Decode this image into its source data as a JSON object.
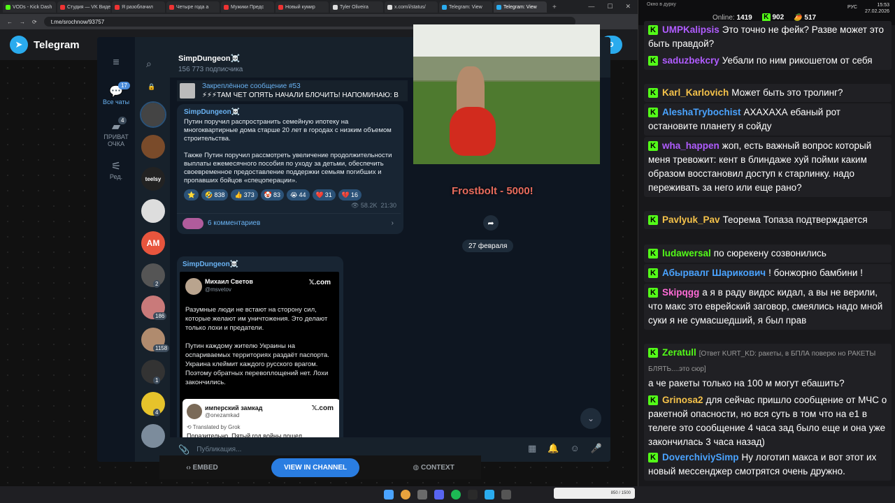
{
  "browser": {
    "tabs": [
      {
        "label": "VODs - Kick Dash",
        "color": "#53fc18"
      },
      {
        "label": "Студия — VK Видео",
        "color": "#e33"
      },
      {
        "label": "Я разоблачил",
        "color": "#e33"
      },
      {
        "label": "Четыре года а",
        "color": "#e33"
      },
      {
        "label": "Мужики Предс",
        "color": "#e33"
      },
      {
        "label": "Новый кумир",
        "color": "#e33"
      },
      {
        "label": "Tyler Oliveira",
        "color": "#ddd"
      },
      {
        "label": "x.com/i/status/",
        "color": "#ddd"
      },
      {
        "label": "Telegram: View",
        "color": "#2aabee"
      },
      {
        "label": "Telegram: View",
        "color": "#2aabee"
      }
    ],
    "url": "t.me/srochnow/93757"
  },
  "telegram_web": {
    "brand": "Telegram",
    "open_button": "D"
  },
  "tg": {
    "rail": {
      "all_chats": "Все чаты",
      "all_badge": "17",
      "private": "ПРИВАТ\nОЧКА",
      "private_badge": "4",
      "edit": "Ред."
    },
    "chat_avatars": [
      {
        "label": "",
        "color": "#444",
        "badge": ""
      },
      {
        "label": "",
        "color": "#7a4b2a",
        "badge": ""
      },
      {
        "label": "teelsy",
        "color": "#222",
        "badge": ""
      },
      {
        "label": "",
        "color": "#ddd",
        "badge": ""
      },
      {
        "label": "AM",
        "color": "#e8553d",
        "badge": ""
      },
      {
        "label": "",
        "color": "#555",
        "badge": "2"
      },
      {
        "label": "",
        "color": "#c97a7a",
        "badge": "186"
      },
      {
        "label": "",
        "color": "#b08b6e",
        "badge": "1158"
      },
      {
        "label": "",
        "color": "#333",
        "badge": "1"
      },
      {
        "label": "",
        "color": "#e6c32b",
        "badge": "4"
      },
      {
        "label": "",
        "color": "#7c8c9c",
        "badge": ""
      }
    ],
    "channel": {
      "title": "SimpDungeon☠️",
      "subscribers": "156 773 подписчика"
    },
    "pinned": {
      "title": "Закреплённое сообщение #53",
      "text": "⚡⚡⚡ТАМ ЧЕТ ОПЯТЬ НАЧАЛИ БЛОЧИТЬ! НАПОМИНАЮ: В"
    },
    "post1": {
      "author": "SimpDungeon☠️",
      "text": "Путин поручил распространить семейную ипотеку на многоквартирные дома старше 20 лет в городах с низким объемом строительства.\n\nТакже Путин поручил рассмотреть увеличение продолжительности выплаты ежемесячного пособия по уходу за детьми, обеспечить своевременное предоставление поддержки семьям погибших и пропавших бойцов «спецоперации».",
      "reactions": [
        {
          "emoji": "⭐",
          "count": ""
        },
        {
          "emoji": "🤣",
          "count": "838"
        },
        {
          "emoji": "👍",
          "count": "373"
        },
        {
          "emoji": "🤡",
          "count": "83"
        },
        {
          "emoji": "😭",
          "count": "44"
        },
        {
          "emoji": "❤️",
          "count": "31"
        },
        {
          "emoji": "💔",
          "count": "16"
        }
      ],
      "views": "👁 58.2K",
      "time": "21:30",
      "comments": "6 комментариев"
    },
    "date_divider": "27 февраля",
    "post2": {
      "author": "SimpDungeon☠️",
      "tweet_name": "Михаил Светов",
      "tweet_handle": "@msvetov",
      "tweet_site": "𝕏.com",
      "tweet_text": "Разумные люди не встают на сторону сил, которые желают им уничтожения. Это делают только лохи и предатели.\n\nПутин каждому жителю Украины на оспариваемых территориях раздаёт паспорта. Украина клеймит каждого русского врагом. Поэтому обратных перевоплощений нет. Лохи закончились.",
      "quote_name": "имперский замкад",
      "quote_handle": "@onezamkad",
      "quote_site": "𝕏.com",
      "quote_translated": "⟲ Translated by Grok",
      "quote_text": "Поразительно. Пятый год войны пошел"
    },
    "composer_placeholder": "Публикация..."
  },
  "overlay": {
    "caption": "Frostbolt - 5000!"
  },
  "extension": {
    "embed": "EMBED",
    "view": "VIEW IN CHANNEL",
    "context": "CONTEXT"
  },
  "chat": {
    "window_title": "Окно в дурку",
    "online_label": "Online:",
    "online": "1419",
    "stat1": "902",
    "stat2": "517",
    "messages": [
      {
        "user": "UMPKalipsis",
        "color": "#b05cff",
        "text": "Это точно не фейк? Разве может это быть правдой?",
        "reply": ""
      },
      {
        "user": "saduzbekcry",
        "color": "#b05cff",
        "text": "Уебали по ним рикошетом от себя",
        "reply": ""
      },
      {
        "user": "Karl_Karlovich",
        "color": "#f5c24a",
        "text": "Может быть это тролинг?",
        "reply": ""
      },
      {
        "user": "AleshaTrybochist",
        "color": "#4aa3ff",
        "text": "АХАХАХА ебаный рот остановите планету я сойду",
        "reply": ""
      },
      {
        "user": "wha_happen",
        "color": "#b05cff",
        "text": "жоп, есть важный вопрос который меня тревожит: кент в блиндаже хуй пойми каким образом восстановил доступ к старлинку. надо переживать за него или еще рано?",
        "reply": ""
      },
      {
        "user": "Pavlyuk_Pav",
        "color": "#f5c24a",
        "text": "Теорема Топаза подтверждается",
        "reply": ""
      },
      {
        "user": "ludawersal",
        "color": "#53fc18",
        "text": "по сюрекену созвонились",
        "reply": ""
      },
      {
        "user": "Абырвалг Шарикович",
        "color": "#4aa3ff",
        "text": "! бонжорно бамбини !",
        "reply": ""
      },
      {
        "user": "Skipqgg",
        "color": "#ff6bd6",
        "text": "а я в раду видос кидал, а вы не верили, что макс это еврейский заговор, смеялись надо мной суки я не сумасшедший, я был прав",
        "reply": ""
      },
      {
        "user": "Zeratull",
        "color": "#53fc18",
        "text": "а че ракеты только на 100 м могут ебашить?",
        "reply": "[Ответ KURT_KD: ракеты, в БПЛА поверю но РАКЕТЫ БЛЯТЬ....это сюр]"
      },
      {
        "user": "Grinosa2",
        "color": "#f5c24a",
        "text": "для сейчас пришло сообщение от МЧС о ракетной опасности, но вся суть в том что на е1 в телеге это сообщение 4 часа зад было еще и она уже закончилась 3 часа назад)",
        "reply": ""
      },
      {
        "user": "DoverchiviySimp",
        "color": "#4aa3ff",
        "text": "Ну логотип макса и вот этот их новый мессенджер смотрятся очень дружно.",
        "reply": ""
      }
    ]
  },
  "taskbar": {
    "lang": "РУС",
    "time": "15:53",
    "date": "27.02.2026",
    "meme_text": "850 / 1500"
  }
}
